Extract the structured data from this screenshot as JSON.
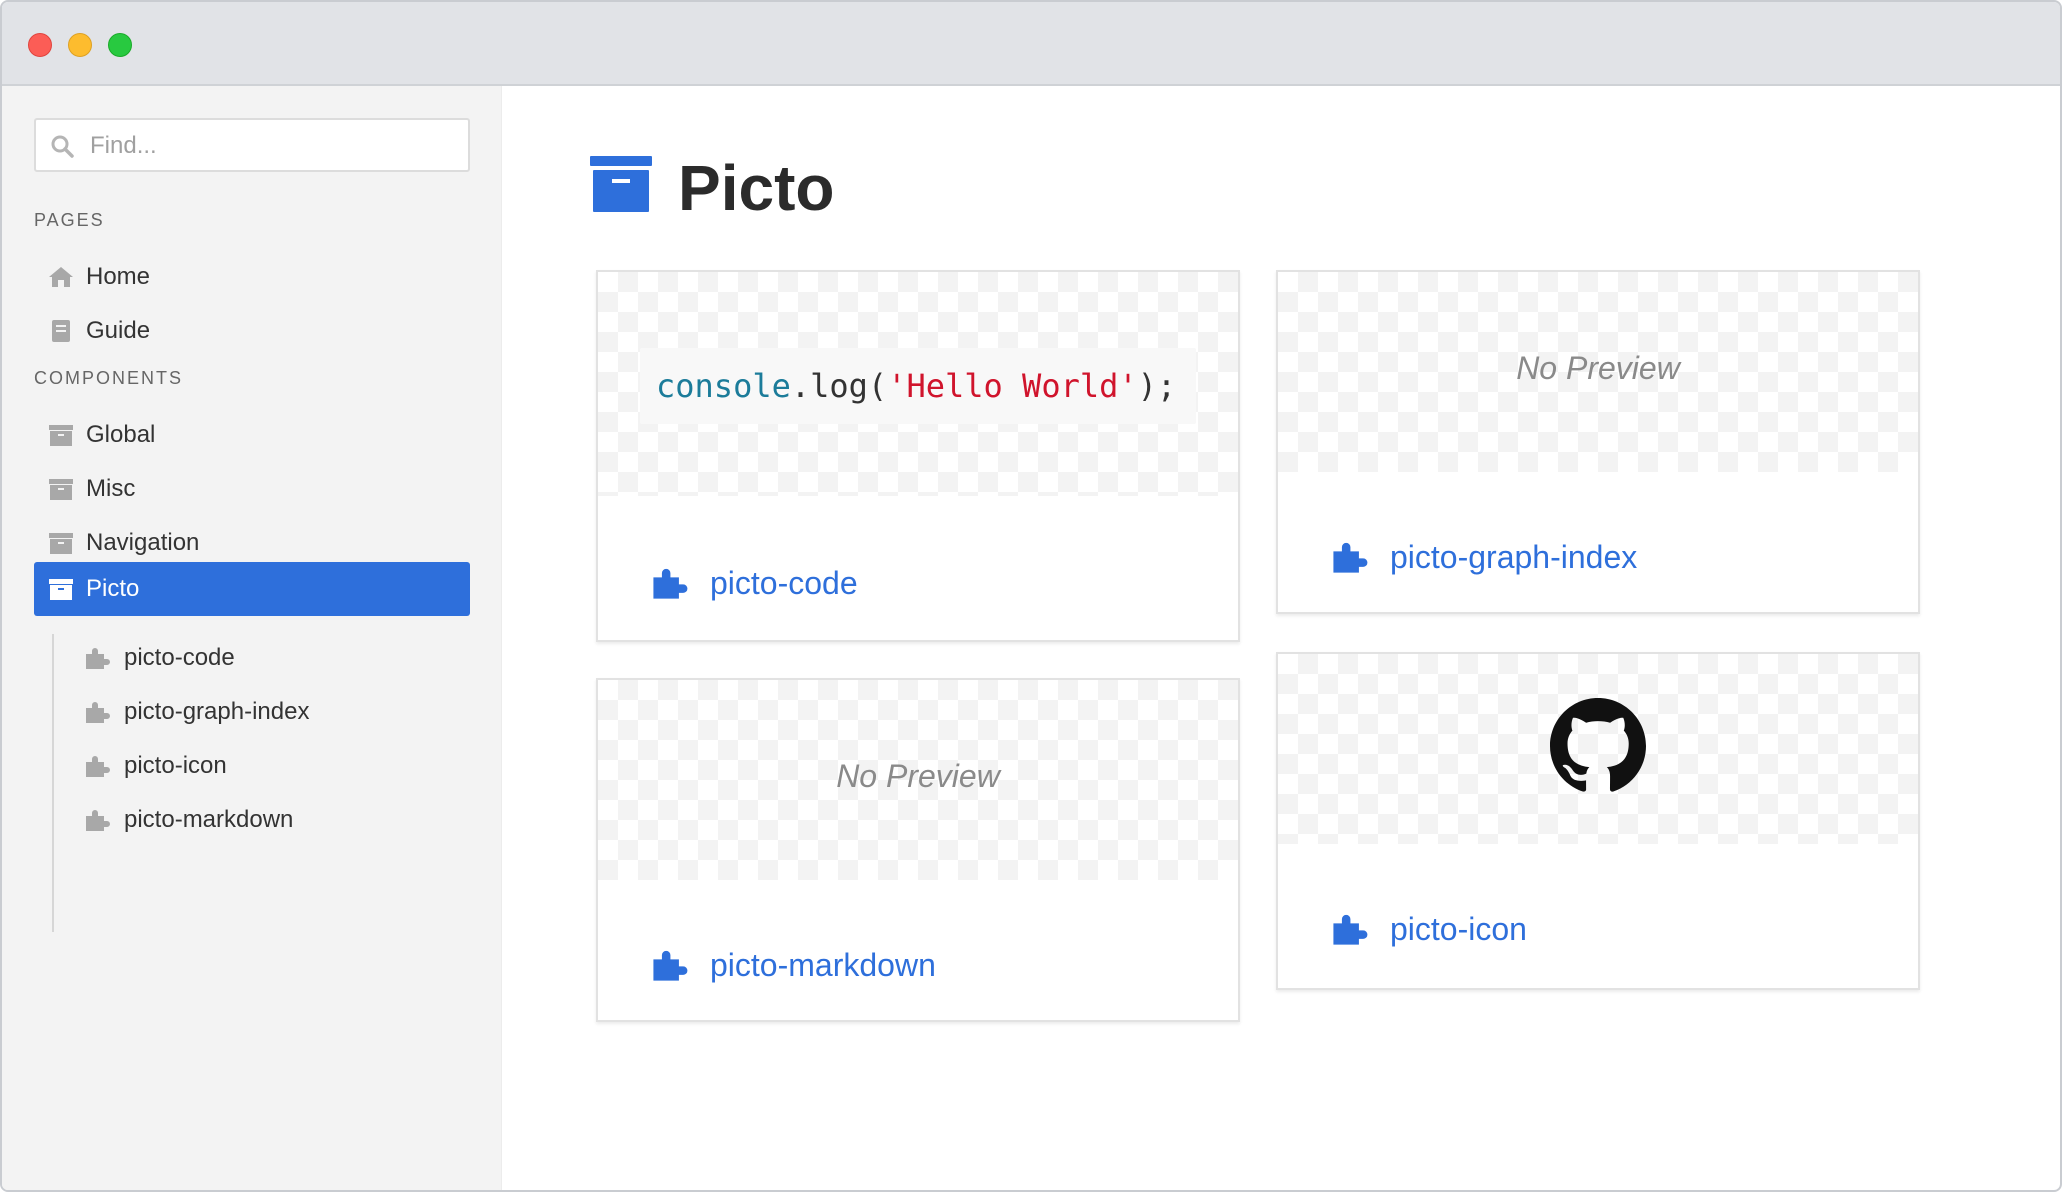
{
  "window": {
    "controls": [
      "close",
      "minimize",
      "maximize"
    ]
  },
  "sidebar": {
    "search": {
      "placeholder": "Find...",
      "value": "",
      "icon": "search-icon"
    },
    "sections": [
      {
        "title": "PAGES",
        "items": [
          {
            "label": "Home",
            "icon": "home-icon"
          },
          {
            "label": "Guide",
            "icon": "book-icon"
          }
        ]
      },
      {
        "title": "COMPONENTS",
        "items": [
          {
            "label": "Global",
            "icon": "archive-icon"
          },
          {
            "label": "Misc",
            "icon": "archive-icon"
          },
          {
            "label": "Navigation",
            "icon": "archive-icon"
          },
          {
            "label": "Picto",
            "icon": "archive-icon",
            "active": true
          }
        ]
      }
    ],
    "sub_items": [
      {
        "label": "picto-code",
        "icon": "puzzle-icon"
      },
      {
        "label": "picto-graph-index",
        "icon": "puzzle-icon"
      },
      {
        "label": "picto-icon",
        "icon": "puzzle-icon"
      },
      {
        "label": "picto-markdown",
        "icon": "puzzle-icon"
      }
    ]
  },
  "main": {
    "title": "Picto",
    "title_icon": "archive-icon",
    "cards": [
      {
        "name": "picto-code",
        "preview": "code",
        "code": {
          "object": "console",
          "dot": ".",
          "method": "log(",
          "string": "'Hello World'",
          "tail": ");"
        }
      },
      {
        "name": "picto-graph-index",
        "preview": "none",
        "preview_text": "No Preview"
      },
      {
        "name": "picto-markdown",
        "preview": "none",
        "preview_text": "No Preview"
      },
      {
        "name": "picto-icon",
        "preview": "github-icon"
      }
    ]
  },
  "colors": {
    "accent": "#2e6fdb",
    "sidebar_bg": "#f3f3f3",
    "titlebar_bg": "#e1e3e7",
    "code_object": "#1c7c9a",
    "code_string": "#d0142c"
  }
}
